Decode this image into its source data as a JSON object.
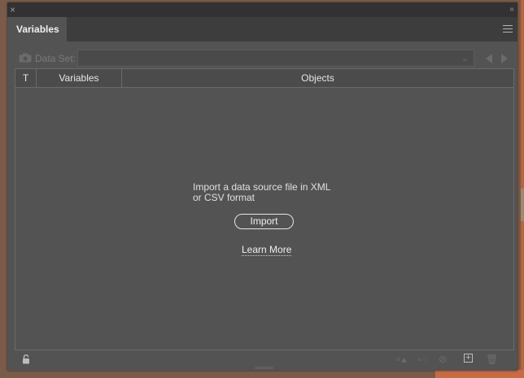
{
  "panel": {
    "close_glyph": "×",
    "collapse_glyph": "‹‹",
    "tab_label": "Variables"
  },
  "dataset": {
    "label": "Data Set:",
    "value": ""
  },
  "table": {
    "headers": [
      "T",
      "Variables",
      "Objects"
    ]
  },
  "empty_state": {
    "message_line1": "Import a data source file in XML",
    "message_line2": "or CSV format",
    "import_label": "Import",
    "learn_more_label": "Learn More"
  },
  "icons": {
    "close": "close-icon",
    "collapse": "collapse-icon",
    "menu": "panel-menu-icon",
    "camera": "capture-dataset-icon",
    "prev": "previous-dataset-icon",
    "next": "next-dataset-icon",
    "lock": "unlock-icon",
    "make_dynamic": "make-object-dynamic-icon",
    "make_visibility": "make-visibility-dynamic-icon",
    "unbind": "unbind-variable-icon",
    "new_variable": "new-variable-icon",
    "delete": "delete-variable-icon"
  }
}
